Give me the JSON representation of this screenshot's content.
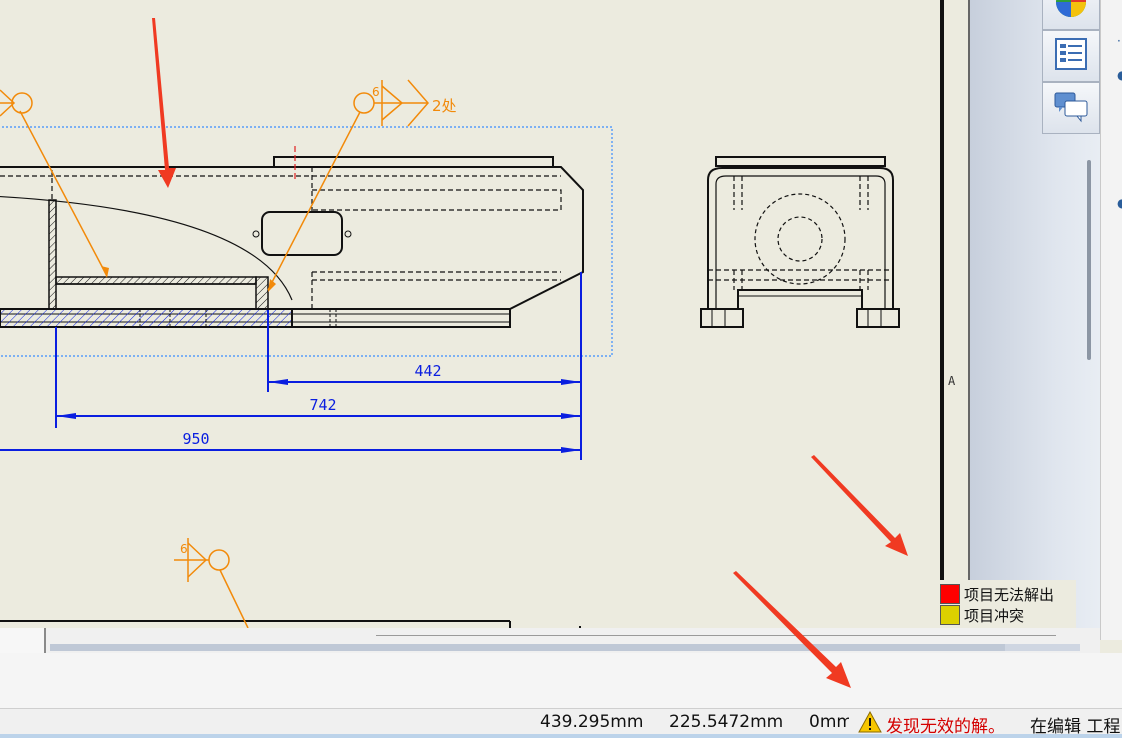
{
  "dimensions": {
    "d442": "442",
    "d742": "742",
    "d950": "950"
  },
  "weld": {
    "count_text": "2处",
    "size_a": "6",
    "size_b": "6",
    "size_c": "6"
  },
  "sheet": {
    "zone_label": "A"
  },
  "legend": {
    "items": [
      {
        "label": "项目无法解出",
        "color": "#ff0000"
      },
      {
        "label": "项目冲突",
        "color": "#dcd000"
      }
    ]
  },
  "status_bar": {
    "x_coord": "439.295mm",
    "y_coord": "225.5472mm",
    "z_coord": "0mm",
    "warning": "发现无效的解。",
    "mode": "在编辑 工程"
  },
  "colors": {
    "dimension": "#0a1ee0",
    "annotation": "#f28a0a",
    "selection": "#3a8cff",
    "arrow": "#f03a22"
  },
  "icons": {
    "task_pane": [
      "appearances-icon",
      "view-palette-icon",
      "forum-icon"
    ],
    "status": "warning-icon"
  }
}
